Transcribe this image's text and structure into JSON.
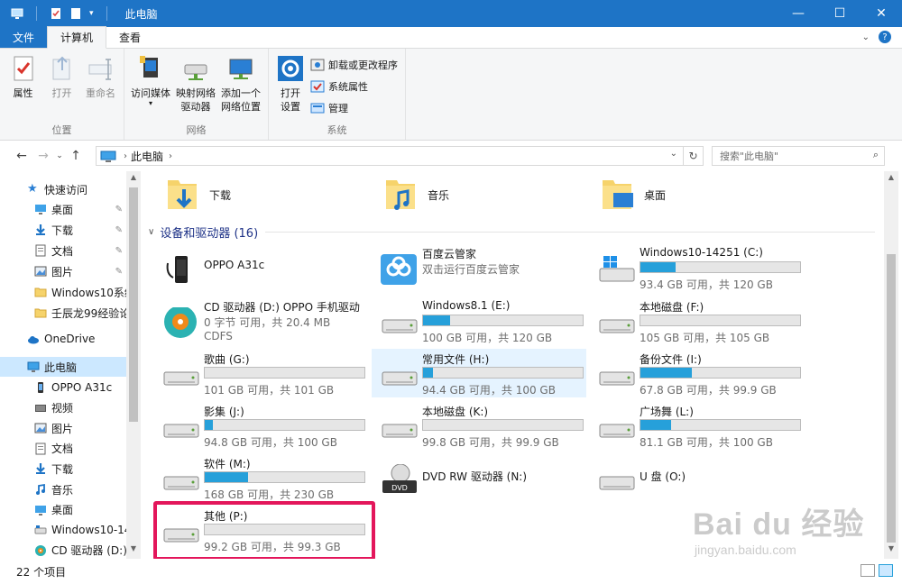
{
  "window": {
    "title": "此电脑",
    "minimize_icon": "minimize-icon",
    "maximize_icon": "maximize-icon",
    "close_icon": "close-icon"
  },
  "ribbon_tabs": {
    "file": "文件",
    "computer": "计算机",
    "view": "查看"
  },
  "ribbon": {
    "location": {
      "label": "位置",
      "properties": "属性",
      "open": "打开",
      "rename": "重命名"
    },
    "network": {
      "label": "网络",
      "access_media_line1": "访问媒体",
      "map_drive_line1": "映射网络",
      "map_drive_line2": "驱动器",
      "add_location_line1": "添加一个",
      "add_location_line2": "网络位置"
    },
    "system": {
      "label": "系统",
      "open_settings_line1": "打开",
      "open_settings_line2": "设置",
      "uninstall": "卸载或更改程序",
      "system_properties": "系统属性",
      "manage": "管理"
    }
  },
  "address": {
    "crumb": "此电脑",
    "search_placeholder": "搜索\"此电脑\""
  },
  "nav": {
    "quick_access": "快速访问",
    "items": [
      {
        "label": "桌面",
        "icon": "desktop-icon",
        "pinned": true
      },
      {
        "label": "下载",
        "icon": "download-icon",
        "pinned": true
      },
      {
        "label": "文档",
        "icon": "document-icon",
        "pinned": true
      },
      {
        "label": "图片",
        "icon": "picture-icon",
        "pinned": true
      },
      {
        "label": "Windows10系统",
        "icon": "folder-icon",
        "pinned": false
      },
      {
        "label": "壬辰龙99经验论",
        "icon": "folder-icon",
        "pinned": false
      }
    ],
    "onedrive": "OneDrive",
    "this_pc": "此电脑",
    "pc_items": [
      {
        "label": "OPPO A31c",
        "icon": "phone-icon"
      },
      {
        "label": "视频",
        "icon": "video-icon"
      },
      {
        "label": "图片",
        "icon": "picture-icon"
      },
      {
        "label": "文档",
        "icon": "document-icon"
      },
      {
        "label": "下载",
        "icon": "download-icon"
      },
      {
        "label": "音乐",
        "icon": "music-icon"
      },
      {
        "label": "桌面",
        "icon": "desktop-icon"
      },
      {
        "label": "Windows10-14",
        "icon": "drive-icon"
      },
      {
        "label": "CD 驱动器 (D:)",
        "icon": "cd-icon"
      }
    ]
  },
  "folders": [
    {
      "label": "下载",
      "icon": "download-folder-icon"
    },
    {
      "label": "音乐",
      "icon": "music-folder-icon"
    },
    {
      "label": "桌面",
      "icon": "desktop-folder-icon"
    }
  ],
  "devices_header": "设备和驱动器 (16)",
  "devices": [
    {
      "name": "OPPO A31c",
      "type": "phone"
    },
    {
      "name": "百度云管家",
      "sub": "双击运行百度云管家",
      "type": "app"
    },
    {
      "name": "Windows10-14251 (C:)",
      "info": "93.4 GB 可用，共 120 GB",
      "used_fraction": 0.22,
      "type": "windows-drive"
    },
    {
      "name": "CD 驱动器 (D:) OPPO 手机驱动",
      "sub": "0 字节 可用，共 20.4 MB",
      "sub2": "CDFS",
      "type": "cd"
    },
    {
      "name": "Windows8.1 (E:)",
      "info": "100 GB 可用，共 120 GB",
      "used_fraction": 0.17,
      "type": "drive"
    },
    {
      "name": "本地磁盘 (F:)",
      "info": "105 GB 可用，共 105 GB",
      "used_fraction": 0.0,
      "type": "drive"
    },
    {
      "name": "歌曲 (G:)",
      "info": "101 GB 可用，共 101 GB",
      "used_fraction": 0.0,
      "type": "drive"
    },
    {
      "name": "常用文件 (H:)",
      "info": "94.4 GB 可用，共 100 GB",
      "used_fraction": 0.06,
      "type": "drive",
      "highlighted": true
    },
    {
      "name": "备份文件 (I:)",
      "info": "67.8 GB 可用，共 99.9 GB",
      "used_fraction": 0.32,
      "type": "drive"
    },
    {
      "name": "影集 (J:)",
      "info": "94.8 GB 可用，共 100 GB",
      "used_fraction": 0.05,
      "type": "drive"
    },
    {
      "name": "本地磁盘 (K:)",
      "info": "99.8 GB 可用，共 99.9 GB",
      "used_fraction": 0.0,
      "type": "drive"
    },
    {
      "name": "广场舞 (L:)",
      "info": "81.1 GB 可用，共 100 GB",
      "used_fraction": 0.19,
      "type": "drive"
    },
    {
      "name": "软件 (M:)",
      "info": "168 GB 可用，共 230 GB",
      "used_fraction": 0.27,
      "type": "drive"
    },
    {
      "name": "DVD RW 驱动器 (N:)",
      "type": "dvd"
    },
    {
      "name": "U 盘 (O:)",
      "type": "usb"
    },
    {
      "name": "其他 (P:)",
      "info": "99.2 GB 可用，共 99.3 GB",
      "used_fraction": 0.0,
      "type": "drive"
    }
  ],
  "status": {
    "count": "22 个项目"
  },
  "watermark": {
    "brand": "Bai du 经验",
    "site": "jingyan.baidu.com"
  },
  "colors": {
    "titlebar": "#1e74c6",
    "bar_fill": "#26a0da",
    "selection": "#cce8ff",
    "annotation_box": "#e3165b",
    "group_header": "#1e3287"
  }
}
